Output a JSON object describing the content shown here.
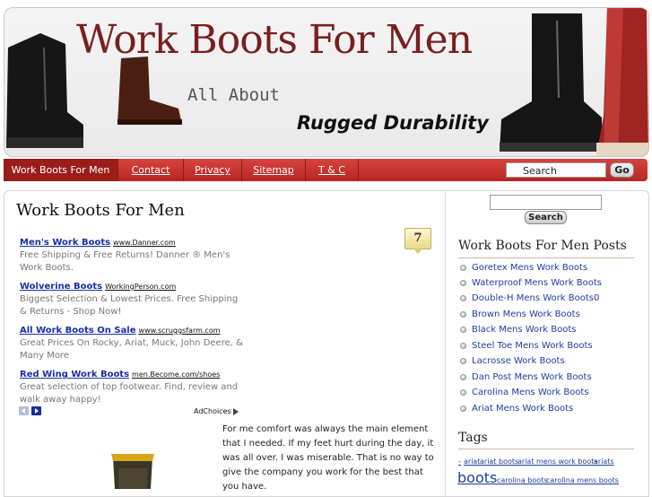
{
  "header": {
    "site_title": "Work Boots For Men",
    "tagline_1": "All About",
    "tagline_2": "Rugged Durability"
  },
  "nav": {
    "items": [
      {
        "label": "Work Boots For Men"
      },
      {
        "label": "Contact"
      },
      {
        "label": "Privacy"
      },
      {
        "label": "Sitemap"
      },
      {
        "label": "T & C"
      }
    ],
    "search_value": "Search",
    "go_label": "Go"
  },
  "post": {
    "title": "Work Boots For Men",
    "comment_count": "7",
    "body": "For me comfort was always the main element that I needed. If my feet hurt during the day, it was all over. I was miserable. That is no way to give the company you work for the best that you have."
  },
  "ads": [
    {
      "title": "Men's Work Boots",
      "url": "www.Danner.com",
      "desc": "Free Shipping & Free Returns! Danner ® Men's Work Boots."
    },
    {
      "title": "Wolverine Boots",
      "url": "WorkingPerson.com",
      "desc": "Biggest Selection & Lowest Prices. Free Shipping & Returns - Shop Now!"
    },
    {
      "title": "All Work Boots On Sale",
      "url": "www.scruggsfarm.com",
      "desc": "Great Prices On Rocky, Ariat, Muck, John Deere, & Many More"
    },
    {
      "title": "Red Wing Work Boots",
      "url": "men.Become.com/shoes",
      "desc": "Great selection of top footwear. Find, review and walk away happy!"
    }
  ],
  "adchoices": "AdChoices",
  "sidebar": {
    "search_button": "Search",
    "posts_title": "Work Boots For Men Posts",
    "posts": [
      "Goretex Mens Work Boots",
      "Waterproof Mens Work Boots",
      "Double-H Mens Work Boots0",
      "Brown Mens Work Boots",
      "Black Mens Work Boots",
      "Steel Toe Mens Work Boots",
      "Lacrosse Work Boots",
      "Dan Post Mens Work Boots",
      "Carolina Mens Work Boots",
      "Ariat Mens Work Boots"
    ],
    "tags_title": "Tags",
    "tags": [
      "-",
      "ariat",
      "ariat boots",
      "ariat mens work boots",
      "ariats",
      "boots",
      "carolina boots",
      "carolina mens boots"
    ]
  },
  "colors": {
    "nav_red": "#c2302b",
    "title_red": "#7a1f1f",
    "link_blue": "#1f3da0"
  }
}
